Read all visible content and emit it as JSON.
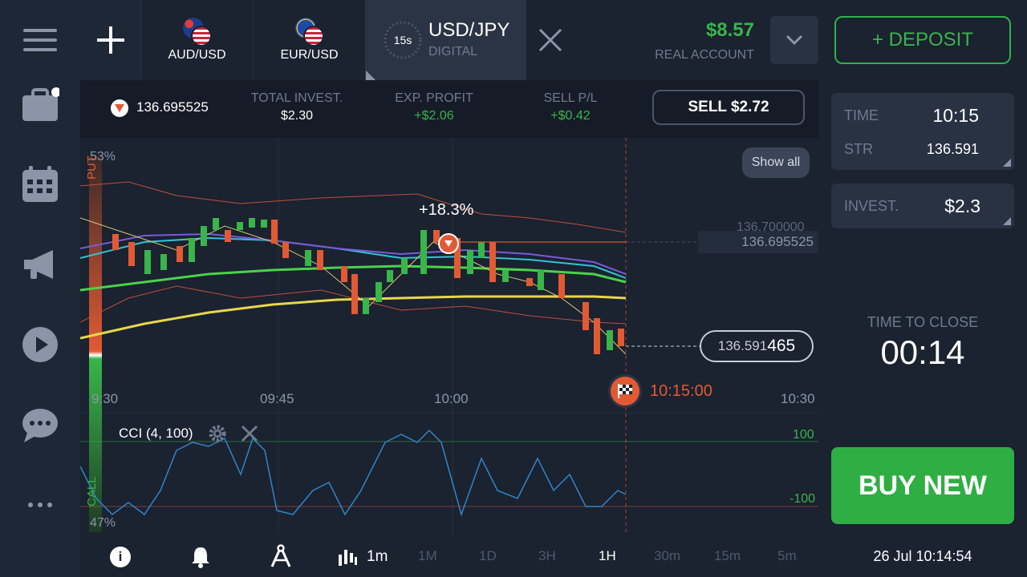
{
  "sidebar": {
    "items": [
      "menu",
      "portfolio",
      "calendar",
      "news",
      "video",
      "chat",
      "more"
    ]
  },
  "tabs": [
    {
      "label": "AUD/USD"
    },
    {
      "label": "EUR/USD"
    }
  ],
  "active_asset": {
    "timer": "15s",
    "name": "USD/JPY",
    "type": "DIGITAL"
  },
  "account": {
    "balance": "$8.57",
    "label": "REAL ACCOUNT"
  },
  "deposit_label": "+ DEPOSIT",
  "position": {
    "price": "136.695525",
    "total_invest_label": "TOTAL INVEST.",
    "total_invest": "$2.30",
    "exp_profit_label": "EXP. PROFIT",
    "exp_profit": "+$2.06",
    "sell_pl_label": "SELL P/L",
    "sell_pl": "+$0.42",
    "sell_button": "SELL $2.72"
  },
  "chart": {
    "put_pct": "53%",
    "call_pct": "47%",
    "put_label": "PUT",
    "call_label": "CALL",
    "show_all": "Show all",
    "profit_badge": "+18.3%",
    "price_line_1": "136.700000",
    "strike_price": "136.695525",
    "current_price_main": "136.591",
    "current_price_tail": "465",
    "expiry_time": "10:15:00",
    "time_labels": [
      "9:30",
      "09:45",
      "10:00",
      "10:30"
    ],
    "indicator_name": "CCI (4, 100)",
    "cci_upper": "100",
    "cci_lower": "-100"
  },
  "trade_panel": {
    "time_label": "TIME",
    "time_value": "10:15",
    "str_label": "STR",
    "str_value": "136.591",
    "invest_label": "INVEST.",
    "invest_value": "$2.3",
    "close_label": "TIME TO CLOSE",
    "close_value": "00:14",
    "buy_button": "BUY NEW"
  },
  "bottombar": {
    "candle_interval": "1m",
    "timeframes": [
      "1M",
      "1D",
      "3H",
      "1H",
      "30m",
      "15m",
      "5m"
    ],
    "active_timeframe": "1H",
    "datetime": "26 Jul 10:14:54"
  },
  "colors": {
    "green": "#39b54a",
    "red": "#e25a33",
    "deposit_border": "#2fb14a"
  }
}
